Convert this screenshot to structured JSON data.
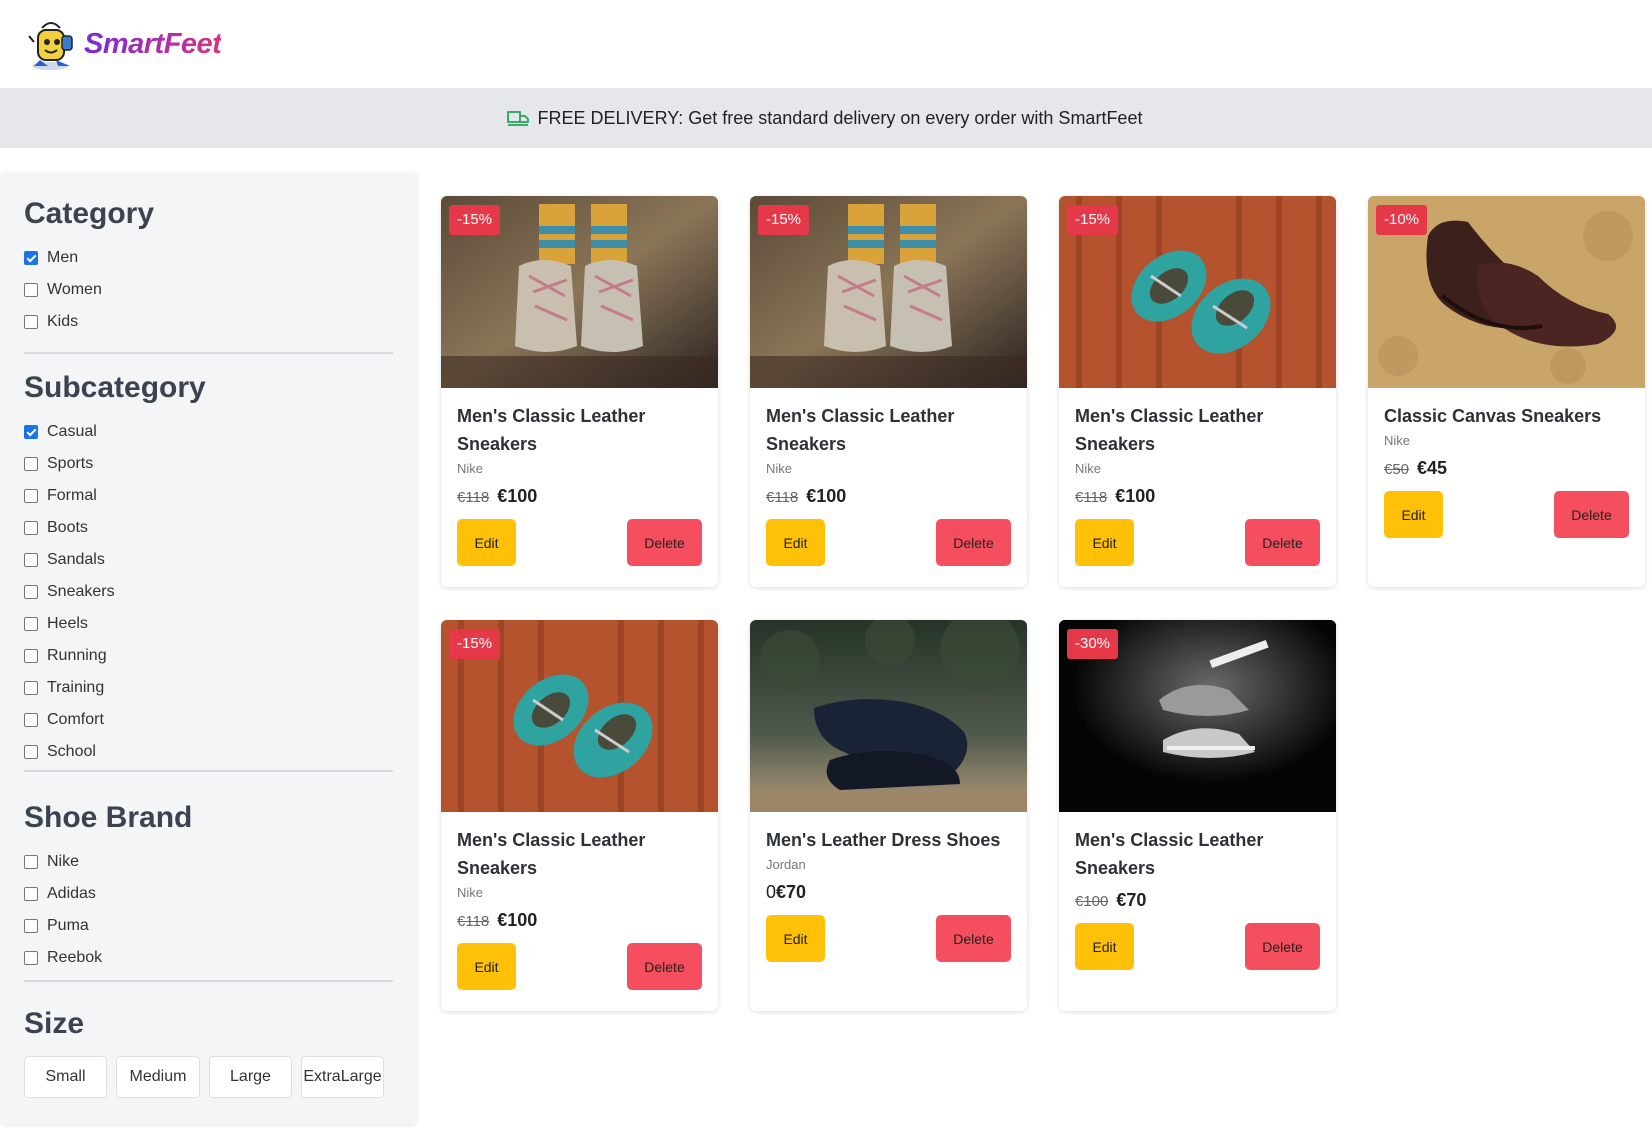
{
  "brand": {
    "name": "SmartFeet"
  },
  "banner": {
    "icon": "truck-icon",
    "text": "FREE DELIVERY: Get free standard delivery on every order with SmartFeet"
  },
  "filters": {
    "category": {
      "title": "Category",
      "options": [
        {
          "label": "Men",
          "checked": true
        },
        {
          "label": "Women",
          "checked": false
        },
        {
          "label": "Kids",
          "checked": false
        }
      ]
    },
    "subcategory": {
      "title": "Subcategory",
      "options": [
        {
          "label": "Casual",
          "checked": true
        },
        {
          "label": "Sports",
          "checked": false
        },
        {
          "label": "Formal",
          "checked": false
        },
        {
          "label": "Boots",
          "checked": false
        },
        {
          "label": "Sandals",
          "checked": false
        },
        {
          "label": "Sneakers",
          "checked": false
        },
        {
          "label": "Heels",
          "checked": false
        },
        {
          "label": "Running",
          "checked": false
        },
        {
          "label": "Training",
          "checked": false
        },
        {
          "label": "Comfort",
          "checked": false
        },
        {
          "label": "School",
          "checked": false
        }
      ]
    },
    "brand": {
      "title": "Shoe Brand",
      "options": [
        {
          "label": "Nike",
          "checked": false
        },
        {
          "label": "Adidas",
          "checked": false
        },
        {
          "label": "Puma",
          "checked": false
        },
        {
          "label": "Reebok",
          "checked": false
        }
      ]
    },
    "size": {
      "title": "Size",
      "options": [
        "Small",
        "Medium",
        "Large",
        "ExtraLarge"
      ]
    }
  },
  "buttons": {
    "edit": "Edit",
    "delete": "Delete"
  },
  "products": [
    {
      "discount": "-15%",
      "title": "Men's Classic Leather Sneakers",
      "brand": "Nike",
      "old_price": "€118",
      "price": "€100",
      "image": "kids-socks-sneakers"
    },
    {
      "discount": "-15%",
      "title": "Men's Classic Leather Sneakers",
      "brand": "Nike",
      "old_price": "€118",
      "price": "€100",
      "image": "kids-socks-sneakers"
    },
    {
      "discount": "-15%",
      "title": "Men's Classic Leather Sneakers",
      "brand": "Nike",
      "old_price": "€118",
      "price": "€100",
      "image": "teal-baby-shoes"
    },
    {
      "discount": "-10%",
      "title": "Classic Canvas Sneakers",
      "brand": "Nike",
      "old_price": "€50",
      "price": "€45",
      "image": "brown-brogues"
    },
    {
      "discount": "-15%",
      "title": "Men's Classic Leather Sneakers",
      "brand": "Nike",
      "old_price": "€118",
      "price": "€100",
      "image": "teal-baby-shoes"
    },
    {
      "discount": "",
      "title": "Men's Leather Dress Shoes",
      "brand": "Jordan",
      "old_price": "0",
      "price": "€70",
      "image": "black-dress-shoes"
    },
    {
      "discount": "-30%",
      "title": "Men's Classic Leather Sneakers",
      "brand": "",
      "old_price": "€100",
      "price": "€70",
      "image": "dark-sneakers"
    }
  ]
}
